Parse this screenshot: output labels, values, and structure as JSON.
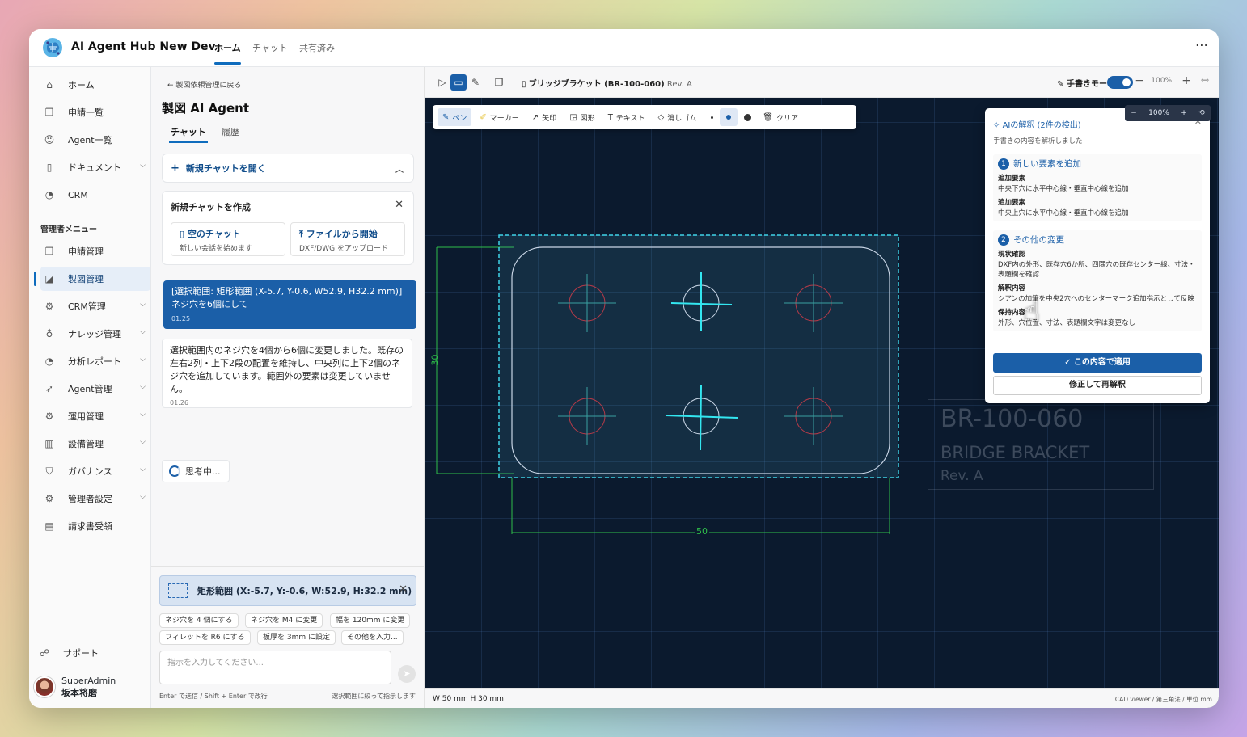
{
  "app": {
    "title": "AI Agent Hub New Dev",
    "tabs": [
      "ホーム",
      "チャット",
      "共有済み"
    ],
    "more": "⋯"
  },
  "sidebar": {
    "items": [
      {
        "label": "ホーム",
        "icon": "home-icon",
        "glyph": "⌂"
      },
      {
        "label": "申請一覧",
        "icon": "document-list-icon",
        "glyph": "❐"
      },
      {
        "label": "Agent一覧",
        "icon": "agent-icon",
        "glyph": "☺"
      },
      {
        "label": "ドキュメント",
        "icon": "document-icon",
        "glyph": "▯",
        "expand": true
      },
      {
        "label": "CRM",
        "icon": "crm-icon",
        "glyph": "◔"
      }
    ],
    "admin_section": "管理者メニュー",
    "admin_items": [
      {
        "label": "申請管理",
        "icon": "request-manage-icon",
        "glyph": "❐"
      },
      {
        "label": "製図管理",
        "icon": "drafting-icon",
        "glyph": "◪",
        "active": true
      },
      {
        "label": "CRM管理",
        "icon": "gear-icon",
        "glyph": "⚙",
        "expand": true
      },
      {
        "label": "ナレッジ管理",
        "icon": "lightbulb-icon",
        "glyph": "♁",
        "expand": true
      },
      {
        "label": "分析レポート",
        "icon": "report-icon",
        "glyph": "◔",
        "expand": true
      },
      {
        "label": "Agent管理",
        "icon": "rocket-icon",
        "glyph": "➶",
        "expand": true
      },
      {
        "label": "運用管理",
        "icon": "gear-icon",
        "glyph": "⚙",
        "expand": true
      },
      {
        "label": "設備管理",
        "icon": "building-icon",
        "glyph": "▥",
        "expand": true
      },
      {
        "label": "ガバナンス",
        "icon": "shield-icon",
        "glyph": "⛉",
        "expand": true
      },
      {
        "label": "管理者設定",
        "icon": "gear-icon",
        "glyph": "⚙",
        "expand": true
      },
      {
        "label": "請求書受領",
        "icon": "invoice-icon",
        "glyph": "▤"
      }
    ],
    "support": "サポート",
    "user": {
      "name": "SuperAdmin",
      "sub": "坂本将磨"
    }
  },
  "chat": {
    "back": "製図依頼管理に戻る",
    "title": "製図 AI Agent",
    "tabs": [
      "チャット",
      "履歴"
    ],
    "new_chat": "新規チャットを開く",
    "create": {
      "heading": "新規チャットを作成",
      "empty_title": "空のチャット",
      "empty_sub": "新しい会話を始めます",
      "file_title": "ファイルから開始",
      "file_sub": "DXF/DWG をアップロード"
    },
    "user_msg": "[選択範囲: 矩形範囲 (X-5.7, Y-0.6, W52.9, H32.2 mm)] ネジ穴を6個にして",
    "user_time": "01:25",
    "agent_msg": "選択範囲内のネジ穴を4個から6個に変更しました。既存の左右2列・上下2段の配置を維持し、中央列に上下2個のネジ穴を追加しています。範囲外の要素は変更していません。",
    "agent_time": "01:26",
    "thinking": "思考中...",
    "range": "矩形範囲 (X:-5.7, Y:-0.6, W:52.9, H:32.2 mm)",
    "chips": [
      "ネジ穴を 4 個にする",
      "ネジ穴を M4 に変更",
      "幅を 120mm に変更",
      "フィレットを R6 にする",
      "板厚を 3mm に設定",
      "その他を入力..."
    ],
    "placeholder": "指示を入力してください...",
    "hint_left": "Enter で送信 / Shift + Enter で改行",
    "hint_right": "選択範囲に絞って指示します"
  },
  "cad": {
    "doc_name": "ブリッジブラケット (BR-100-060)",
    "doc_rev": "Rev. A",
    "handwriting": "手書きモード",
    "zoom": "100%",
    "tools": [
      "ペン",
      "マーカー",
      "矢印",
      "図形",
      "テキスト",
      "消しゴム",
      "クリア"
    ],
    "dim_h": "30",
    "dim_w": "50",
    "title_block": {
      "part": "BR-100-060",
      "name": "BRIDGE BRACKET",
      "rev": "Rev. A"
    },
    "ai_panel": {
      "heading": "AIの解釈 (2件の検出)",
      "sub": "手書きの内容を解析しました",
      "s1_title": "新しい要素を追加",
      "s1_l1": "追加要素",
      "s1_t1": "中央下穴に水平中心線・垂直中心線を追加",
      "s1_l2": "追加要素",
      "s1_t2": "中央上穴に水平中心線・垂直中心線を追加",
      "s2_title": "その他の変更",
      "s2_l1": "現状確認",
      "s2_t1": "DXF内の外形、既存穴6か所、四隅穴の既存センター線、寸法・表題欄を確認",
      "s2_l2": "解釈内容",
      "s2_t2": "シアンの加筆を中央2穴へのセンターマーク追加指示として反映",
      "s2_l3": "保持内容",
      "s2_t3": "外形、穴位置、寸法、表題欄文字は変更なし",
      "apply": "この内容で適用",
      "redo": "修正して再解釈"
    },
    "mini_zoom": "100%",
    "status_left": "W 50 mm   H 30 mm",
    "status_right": "CAD viewer / 第三角法 / 単位 mm"
  }
}
